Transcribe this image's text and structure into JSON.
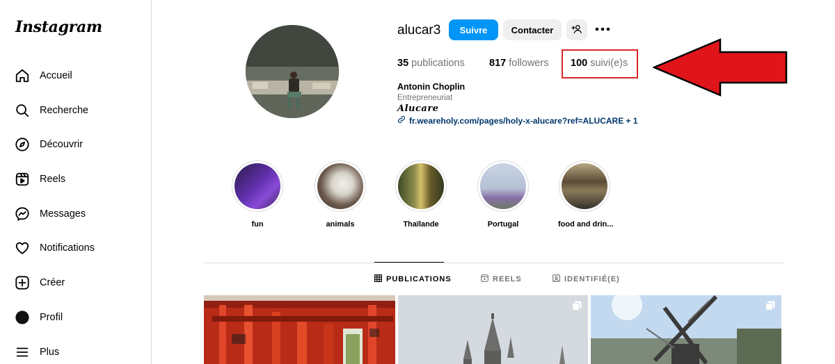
{
  "sidebar": {
    "logo": "Instagram",
    "items": [
      {
        "label": "Accueil",
        "icon": "home-icon"
      },
      {
        "label": "Recherche",
        "icon": "search-icon"
      },
      {
        "label": "Découvrir",
        "icon": "compass-icon"
      },
      {
        "label": "Reels",
        "icon": "reels-icon"
      },
      {
        "label": "Messages",
        "icon": "messenger-icon"
      },
      {
        "label": "Notifications",
        "icon": "heart-icon"
      },
      {
        "label": "Créer",
        "icon": "plus-square-icon"
      },
      {
        "label": "Profil",
        "icon": "avatar"
      },
      {
        "label": "Plus",
        "icon": "menu-icon"
      }
    ]
  },
  "profile": {
    "username": "alucar3",
    "follow_label": "Suivre",
    "contact_label": "Contacter",
    "stats": {
      "posts_count": "35",
      "posts_label": "publications",
      "followers_count": "817",
      "followers_label": "followers",
      "following_count": "100",
      "following_label": "suivi(e)s"
    },
    "full_name": "Antonin Choplin",
    "category": "Entrepreneuriat",
    "bio": "Alucare",
    "link": "fr.weareholy.com/pages/holy-x-alucare?ref=ALUCARE + 1"
  },
  "highlights": [
    {
      "label": "fun"
    },
    {
      "label": "animals"
    },
    {
      "label": "Thaïlande"
    },
    {
      "label": "Portugal"
    },
    {
      "label": "food and drin..."
    }
  ],
  "tabs": [
    {
      "label": "PUBLICATIONS",
      "icon": "grid-icon",
      "active": true
    },
    {
      "label": "REELS",
      "icon": "reels-icon",
      "active": false
    },
    {
      "label": "IDENTIFIÉ(E)",
      "icon": "tagged-icon",
      "active": false
    }
  ],
  "colors": {
    "accent": "#0095f6",
    "highlight_box": "#d9252a",
    "arrow": "#e0151b"
  }
}
